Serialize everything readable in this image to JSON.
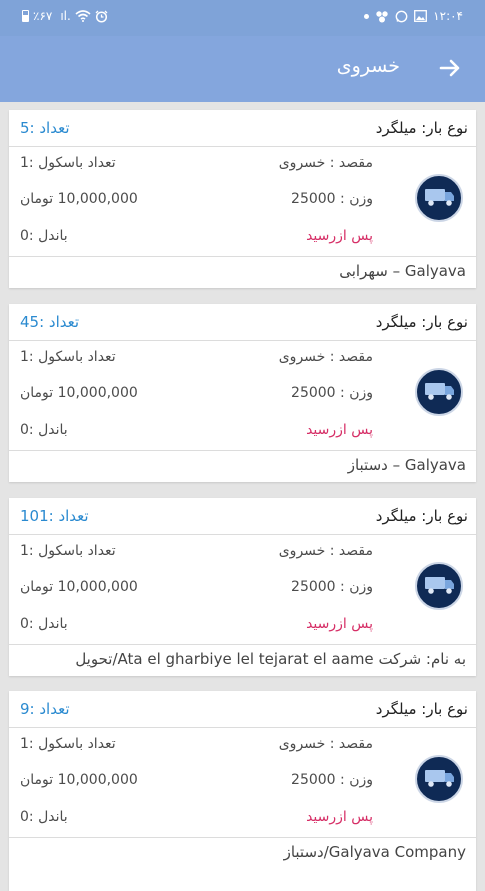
{
  "status_bar": {
    "battery": "٪۶۷",
    "signal": "ıl.",
    "time": "۱۲:۰۴",
    "left_icons": [
      "battery-icon",
      "signal-icon",
      "wifi-icon",
      "alarm-icon"
    ],
    "right_icons": [
      "dot-icon",
      "group-icon",
      "whatsapp-icon",
      "gallery-icon"
    ]
  },
  "header": {
    "title": "خسروی",
    "back_icon": "arrow-right-icon"
  },
  "colors": {
    "header": "#84a6dd",
    "accent": "#2a8ad0",
    "status": "#d62e66"
  },
  "loads": [
    {
      "cargo_type": "نوع بار: میلگرد",
      "count": "تعداد :5",
      "destination": "مقصد : خسروی",
      "trucks": "تعداد باسکول :1",
      "weight": "وزن : 25000",
      "price": "10,000,000 تومان",
      "payment": "پس ازرسید",
      "bundle": "باندل :0",
      "company": "Galyava – سهرابی"
    },
    {
      "cargo_type": "نوع بار: میلگرد",
      "count": "تعداد :45",
      "destination": "مقصد : خسروی",
      "trucks": "تعداد باسکول :1",
      "weight": "وزن : 25000",
      "price": "10,000,000 تومان",
      "payment": "پس ازرسید",
      "bundle": "باندل :0",
      "company": "Galyava – دستباز"
    },
    {
      "cargo_type": "نوع بار: میلگرد",
      "count": "تعداد :101",
      "destination": "مقصد : خسروی",
      "trucks": "تعداد باسکول :1",
      "weight": "وزن : 25000",
      "price": "10,000,000 تومان",
      "payment": "پس ازرسید",
      "bundle": "باندل :0",
      "company": "به نام: شرکت Ata el gharbiye lel tejarat el aame/تحویل"
    },
    {
      "cargo_type": "نوع بار: میلگرد",
      "count": "تعداد :9",
      "destination": "مقصد : خسروی",
      "trucks": "تعداد باسکول :1",
      "weight": "وزن : 25000",
      "price": "10,000,000 تومان",
      "payment": "پس ازرسید",
      "bundle": "باندل :0",
      "company": "Galyava Company/دستباز"
    }
  ]
}
